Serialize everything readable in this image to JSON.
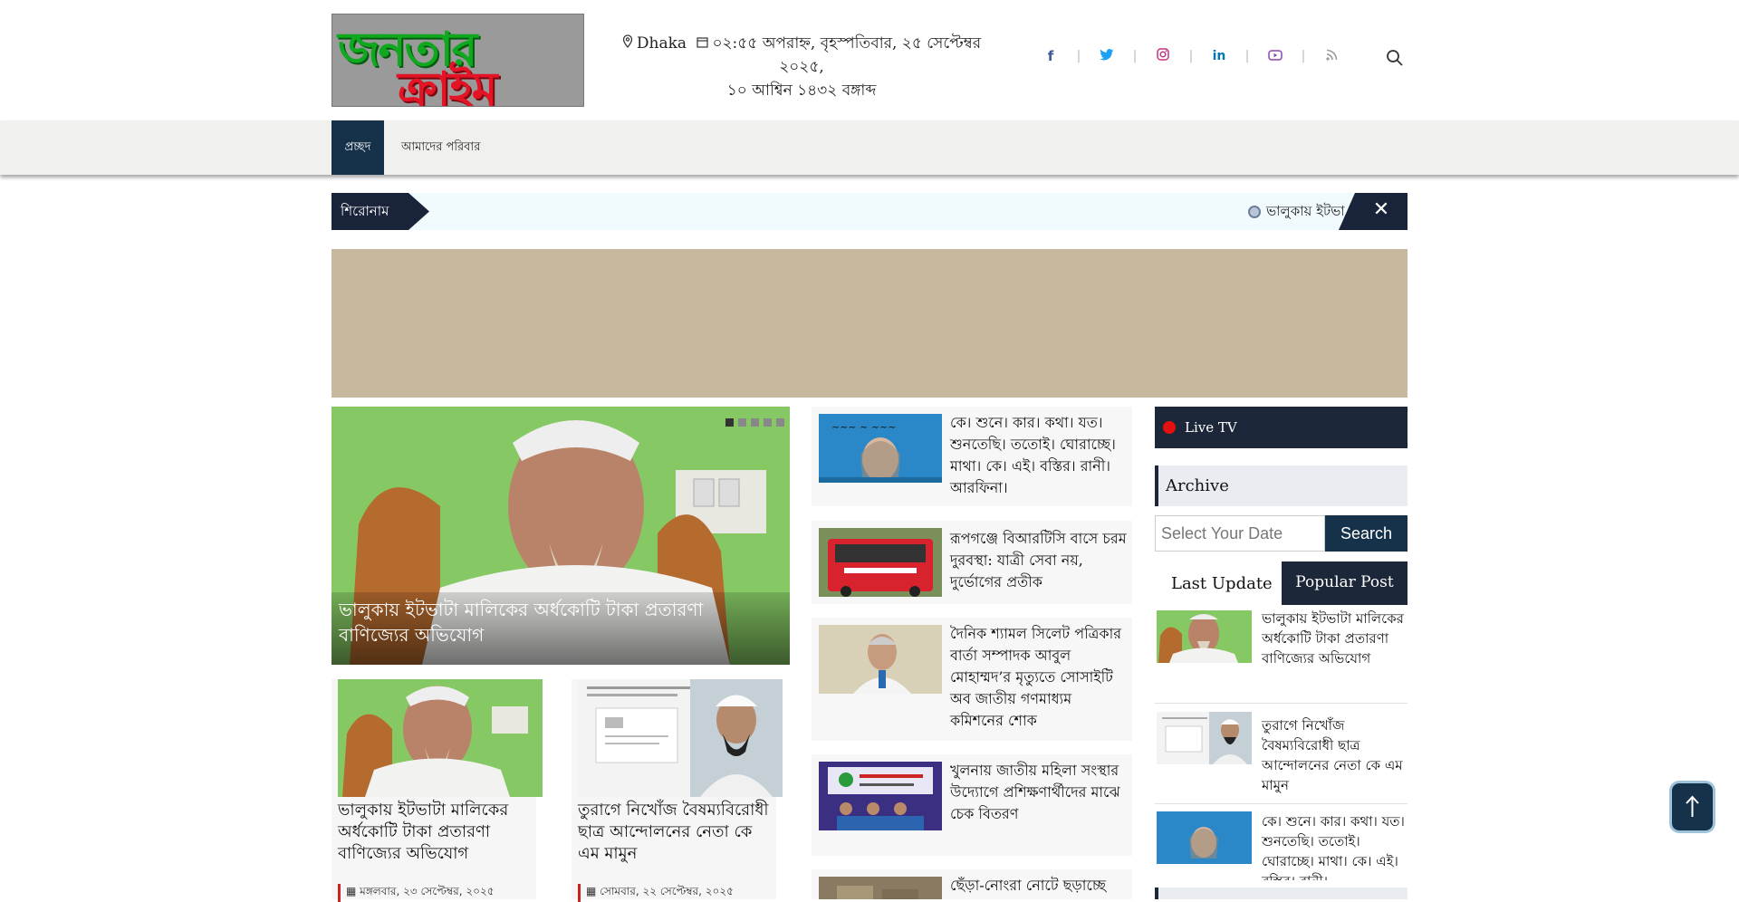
{
  "logo": {
    "line1": "জনতার",
    "line2": "ক্রাইম"
  },
  "header": {
    "location": "Dhaka",
    "datetime_line1": "০২:৫৫ অপরাহ্ন, বৃহস্পতিবার, ২৫ সেপ্টেম্বর ২০২৫,",
    "datetime_line2": "১০ আশ্বিন ১৪৩২ বঙ্গাব্দ",
    "social": [
      {
        "icon": "facebook-icon",
        "glyph": "f",
        "color": "#3b5998"
      },
      {
        "icon": "twitter-icon",
        "glyph": "🐦",
        "color": "#1da1f2"
      },
      {
        "icon": "instagram-icon",
        "glyph": "◎",
        "color": "#c13584"
      },
      {
        "icon": "linkedin-icon",
        "glyph": "in",
        "color": "#0077b5"
      },
      {
        "icon": "youtube-icon",
        "glyph": "▶",
        "color": "#8e44ad"
      },
      {
        "icon": "rss-icon",
        "glyph": "⧉",
        "color": "#999999"
      }
    ],
    "separator": "|"
  },
  "nav": {
    "home": "প্রচ্ছদ",
    "family": "আমাদের পরিবার"
  },
  "ticker": {
    "label": "শিরোনাম",
    "text": "ভালুকায় ইটভা",
    "close": "✕"
  },
  "hero": {
    "title": "ভালুকায় ইটভাটা মালিকের অর্ধকোটি টাকা প্রতারণা বাণিজ্যের অভিযোগ",
    "slides": 5
  },
  "cards": [
    {
      "title": "ভালুকায় ইটভাটা মালিকের অর্ধকোটি টাকা প্রতারণা বাণিজ্যের অভিযোগ",
      "date": "মঙ্গলবার, ২৩ সেপ্টেম্বর, ২০২৫"
    },
    {
      "title": "তুরাগে নিখোঁজ বৈষম্যবিরোধী ছাত্র আন্দোলনের নেতা কে এম মামুন",
      "date": "সোমবার, ২২ সেপ্টেম্বর, ২০২৫"
    }
  ],
  "list": [
    {
      "title": "কে। শুনে। কার। কথা। যত। শুনতেছি। ততোই। ঘোরাচ্ছে। মাথা। কে। এই। বস্তির। রানী। আরফিনা।"
    },
    {
      "title": "রূপগঞ্জে বিআরটিসি বাসে চরম দুরবস্থা: যাত্রী সেবা নয়, দুর্ভোগের প্রতীক"
    },
    {
      "title": "দৈনিক শ্যামল সিলেট পত্রিকার বার্তা সম্পাদক আবুল মোহাম্মদ’র মৃত্যুতে সোসাইটি অব জাতীয় গণমাধ্যম কমিশনের শোক"
    },
    {
      "title": "খুলনায় জাতীয় মহিলা সংস্থার উদ্যোগে প্রশিক্ষণার্থীদের মাঝে চেক বিতরণ"
    },
    {
      "title": "ছেঁড়া-নোংরা নোটে ছড়াচ্ছে"
    }
  ],
  "sidebar": {
    "live": "Live TV",
    "archive": "Archive",
    "date_placeholder": "Select Your Date",
    "search": "Search",
    "tab_last": "Last Update",
    "tab_popular": "Popular Post",
    "items": [
      {
        "title": "ভালুকায় ইটভাটা মালিকের অর্ধকোটি টাকা প্রতারণা বাণিজ্যের অভিযোগ"
      },
      {
        "title": "তুরাগে নিখোঁজ বৈষম্যবিরোধী ছাত্র আন্দোলনের নেতা কে এম মামুন"
      },
      {
        "title": "কে। শুনে। কার। কথা। যত। শুনতেছি। ততোই। ঘোরাচ্ছে। মাথা। কে। এই। বস্তির। রানী।"
      }
    ]
  },
  "colors": {
    "navy": "#16324a",
    "dark": "#1c2739",
    "red": "#e31426",
    "green": "#0fa81e"
  }
}
